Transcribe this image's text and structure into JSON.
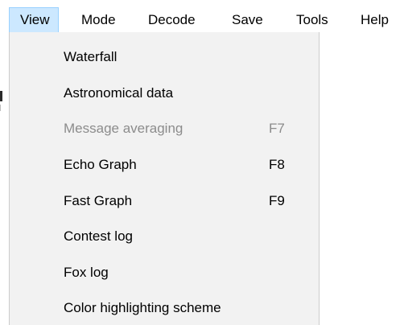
{
  "menubar": {
    "items": [
      "View",
      "Mode",
      "Decode",
      "Save",
      "Tools",
      "Help"
    ],
    "active": "View"
  },
  "view_menu": {
    "items": [
      {
        "label": "Waterfall",
        "shortcut": "",
        "enabled": true
      },
      {
        "label": "Astronomical data",
        "shortcut": "",
        "enabled": true
      },
      {
        "label": "Message averaging",
        "shortcut": "F7",
        "enabled": false
      },
      {
        "label": "Echo Graph",
        "shortcut": "F8",
        "enabled": true
      },
      {
        "label": "Fast Graph",
        "shortcut": "F9",
        "enabled": true
      },
      {
        "label": "Contest log",
        "shortcut": "",
        "enabled": true
      },
      {
        "label": "Fox log",
        "shortcut": "",
        "enabled": true
      },
      {
        "label": "Color highlighting scheme",
        "shortcut": "",
        "enabled": true
      }
    ]
  },
  "colors": {
    "menu_background": "#f2f2f2",
    "active_highlight": "#cce8ff",
    "active_border": "#99d1ff",
    "disabled_text": "#8c8c8c"
  }
}
